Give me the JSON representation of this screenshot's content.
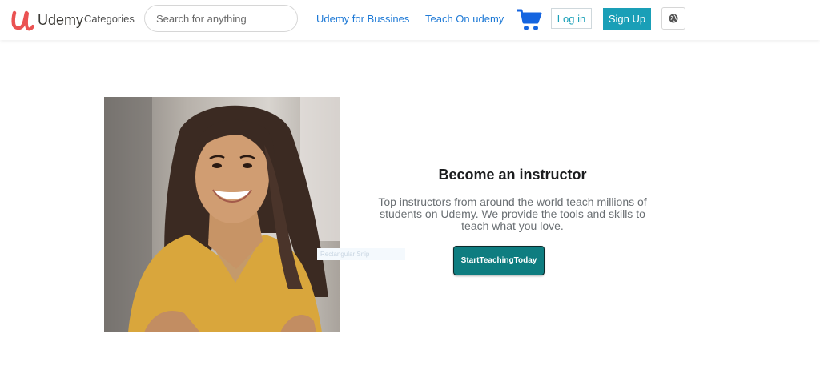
{
  "brand": {
    "name": "Udemy",
    "color": "#ea5252"
  },
  "nav": {
    "categories": "Categories",
    "search_placeholder": "Search for anything",
    "business_link": "Udemy for Bussines",
    "teach_link": "Teach On udemy",
    "cart_icon": "shopping-cart-icon",
    "login_label": "Log in",
    "signup_label": "Sign Up",
    "globe_icon": "globe-icon"
  },
  "hero": {
    "photo": "smiling woman in yellow top with arms crossed",
    "title": "Become an instructor",
    "description": "Top instructors from around the world teach millions of students on Udemy. We provide the tools and skills to teach what you love.",
    "faint_field_text": "Rectangular Snip",
    "cta_label": "StartTeachingToday"
  },
  "colors": {
    "link": "#1f7ad6",
    "signup_bg": "#1a9fb7",
    "cta_bg": "#0e7d80",
    "cart": "#1565e0"
  }
}
